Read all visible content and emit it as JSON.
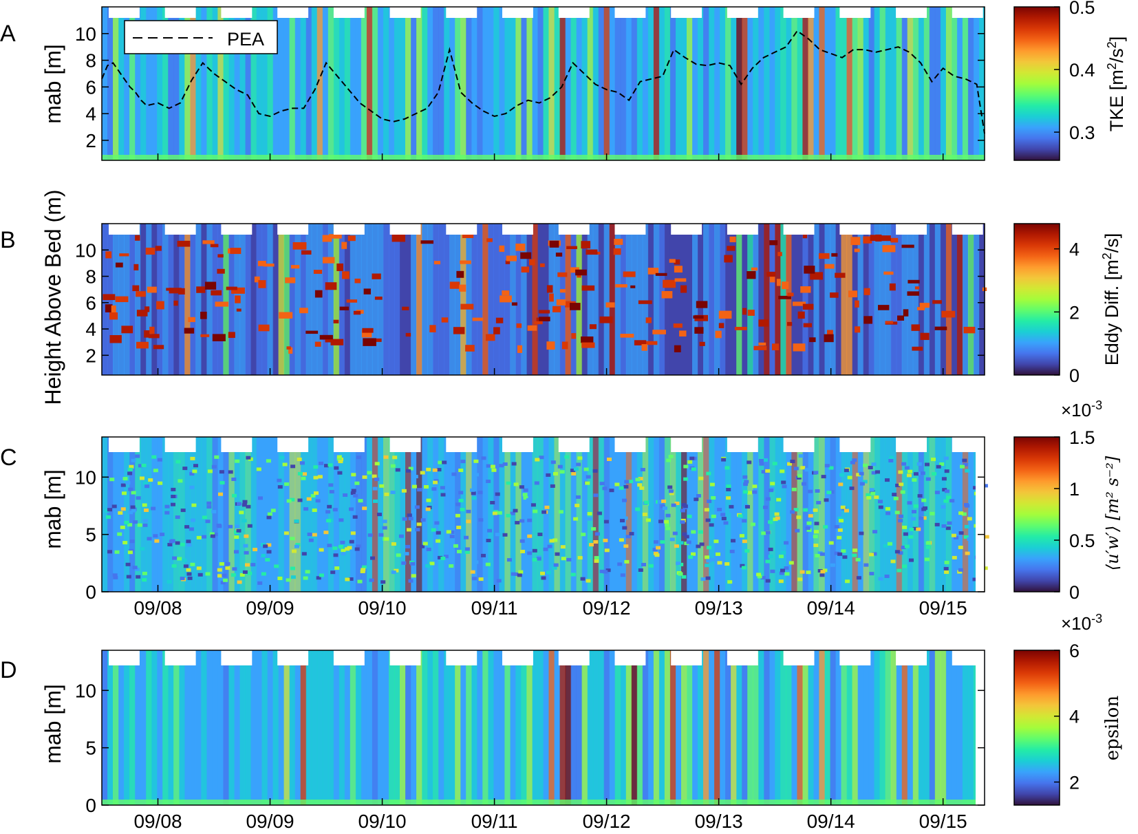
{
  "colormap": [
    "#30123b",
    "#4145ab",
    "#4675ed",
    "#39a2fc",
    "#1bcfd4",
    "#24eca6",
    "#61fc6c",
    "#a4fc3b",
    "#d1e834",
    "#f3c63a",
    "#fe9b2d",
    "#f36315",
    "#d93806",
    "#b11901",
    "#7a0402"
  ],
  "shared_x": {
    "tick_labels": [
      "09/08",
      "09/09",
      "09/10",
      "09/11",
      "09/12",
      "09/13",
      "09/14",
      "09/15"
    ],
    "tick_days": [
      8,
      9,
      10,
      11,
      12,
      13,
      14,
      15
    ],
    "range_days": [
      7.5,
      15.37
    ]
  },
  "shared_ylabel": "Height Above Bed (m)",
  "chart_data": [
    {
      "type": "heatmap",
      "panel_letter": "A",
      "ylabel": "mab [m]",
      "yticks": [
        2,
        4,
        6,
        8,
        10
      ],
      "ylim": [
        0.5,
        12
      ],
      "colorbar": {
        "label_base": "TKE [m",
        "label_sup1": "2",
        "label_mid": "/s",
        "label_sup2": "2",
        "label_end": "]",
        "ticks": [
          0.3,
          0.4,
          0.5
        ],
        "tick_labels": [
          "0.3",
          "0.4",
          "0.5"
        ],
        "range": [
          0.255,
          0.5
        ]
      },
      "legend": {
        "entry": "PEA",
        "position": "top-left"
      },
      "series": [
        {
          "name": "PEA",
          "style": "dashed",
          "x": [
            7.5,
            7.55,
            7.6,
            7.65,
            7.7,
            7.75,
            7.8,
            7.85,
            7.9,
            8.0,
            8.1,
            8.2,
            8.3,
            8.4,
            8.5,
            8.6,
            8.7,
            8.8,
            8.9,
            9.0,
            9.1,
            9.2,
            9.3,
            9.4,
            9.5,
            9.6,
            9.7,
            9.8,
            9.9,
            10.0,
            10.1,
            10.2,
            10.3,
            10.4,
            10.5,
            10.6,
            10.7,
            10.8,
            10.9,
            11.0,
            11.1,
            11.2,
            11.3,
            11.4,
            11.5,
            11.6,
            11.7,
            11.8,
            11.9,
            12.0,
            12.1,
            12.2,
            12.3,
            12.4,
            12.5,
            12.6,
            12.7,
            12.8,
            12.9,
            13.0,
            13.1,
            13.2,
            13.3,
            13.4,
            13.5,
            13.6,
            13.7,
            13.8,
            13.9,
            14.0,
            14.1,
            14.2,
            14.3,
            14.4,
            14.5,
            14.6,
            14.7,
            14.8,
            14.9,
            15.0,
            15.1,
            15.2,
            15.3,
            15.37
          ],
          "y": [
            6.6,
            7.6,
            7.8,
            7.2,
            6.6,
            6.0,
            5.6,
            5.0,
            4.6,
            4.8,
            4.4,
            4.8,
            6.5,
            7.8,
            7.0,
            6.4,
            5.8,
            5.4,
            4.0,
            3.8,
            4.2,
            4.4,
            4.4,
            5.8,
            7.8,
            6.8,
            5.8,
            4.8,
            4.2,
            3.6,
            3.4,
            3.6,
            4.0,
            4.4,
            5.6,
            8.8,
            5.6,
            4.8,
            4.2,
            3.8,
            4.0,
            4.6,
            5.0,
            4.8,
            5.2,
            6.0,
            7.8,
            7.0,
            6.2,
            5.8,
            5.6,
            5.0,
            6.4,
            6.6,
            6.8,
            8.8,
            8.2,
            7.7,
            7.6,
            7.8,
            7.6,
            6.2,
            7.4,
            8.2,
            8.6,
            9.0,
            10.2,
            9.6,
            8.8,
            8.5,
            8.2,
            8.8,
            8.8,
            8.6,
            8.8,
            9.0,
            8.6,
            7.8,
            6.4,
            7.4,
            6.8,
            6.6,
            6.2,
            2.5
          ]
        }
      ]
    },
    {
      "type": "heatmap",
      "panel_letter": "B",
      "ylabel": "",
      "yticks": [
        2,
        4,
        6,
        8,
        10
      ],
      "ylim": [
        0.5,
        12
      ],
      "colorbar": {
        "label_base": "Eddy Diff. [m",
        "label_sup1": "2",
        "label_mid": "/s]",
        "ticks": [
          0,
          2,
          4
        ],
        "tick_labels": [
          "0",
          "2",
          "4"
        ],
        "range": [
          0,
          4.8
        ]
      }
    },
    {
      "type": "heatmap",
      "panel_letter": "C",
      "ylabel": "mab [m]",
      "yticks": [
        0,
        5,
        10
      ],
      "ylim": [
        0,
        13.5
      ],
      "colorbar": {
        "label": "⟨u′w′⟩ [m² s⁻²]",
        "exponent": "×10",
        "exponent_power": "-3",
        "ticks": [
          0,
          0.5,
          1,
          1.5
        ],
        "tick_labels": [
          "0",
          "0.5",
          "1",
          "1.5"
        ],
        "range": [
          0,
          1.5
        ]
      }
    },
    {
      "type": "heatmap",
      "panel_letter": "D",
      "ylabel": "mab [m]",
      "yticks": [
        0,
        5,
        10
      ],
      "ylim": [
        0,
        13.5
      ],
      "colorbar": {
        "label": "epsilon",
        "exponent": "×10",
        "exponent_power": "-3",
        "ticks": [
          2,
          4,
          6
        ],
        "tick_labels": [
          "2",
          "4",
          "6"
        ],
        "range": [
          1.3,
          6
        ]
      }
    }
  ]
}
